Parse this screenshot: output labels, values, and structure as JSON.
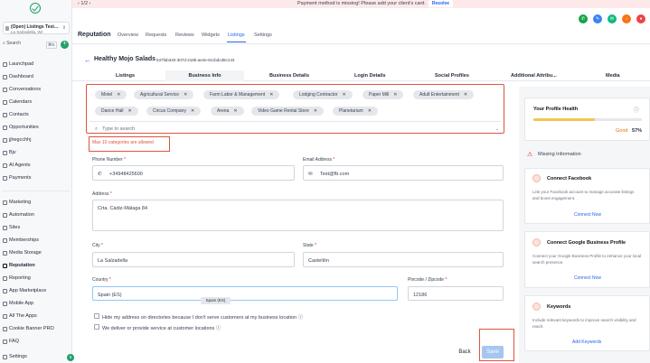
{
  "sidebar": {
    "location_name": "(Open) Listings Test...",
    "location_sub": "La Salzadella, WI",
    "search_label": "Search",
    "search_shortcut": "⌘K",
    "add_label": "+",
    "items": [
      {
        "label": "Launchpad"
      },
      {
        "label": "Dashboard"
      },
      {
        "label": "Conversations"
      },
      {
        "label": "Calendars"
      },
      {
        "label": "Contacts"
      },
      {
        "label": "Opportunities"
      },
      {
        "label": "jjhegcchhj"
      },
      {
        "label": "Bjv"
      },
      {
        "label": "AI Agents"
      },
      {
        "label": "Payments"
      },
      {
        "label": "Marketing"
      },
      {
        "label": "Automation"
      },
      {
        "label": "Sites"
      },
      {
        "label": "Memberships"
      },
      {
        "label": "Media Storage"
      },
      {
        "label": "Reputation"
      },
      {
        "label": "Reporting"
      },
      {
        "label": "App Marketplace"
      },
      {
        "label": "Mobile App"
      },
      {
        "label": "All The Apps"
      },
      {
        "label": "Cookie Banner PRO"
      },
      {
        "label": "FAQ"
      },
      {
        "label": "Settings"
      }
    ],
    "badge": "6"
  },
  "topbar": {
    "page": "1/2",
    "message": "Payment method is missing! Please add your client's card.",
    "resolve": "Resolve"
  },
  "header": {
    "title": "Reputation",
    "tabs": [
      "Overview",
      "Requests",
      "Reviews",
      "Widgets",
      "Listings",
      "Settings"
    ]
  },
  "listing": {
    "back": "←",
    "name": "Healthy Mojo Salads",
    "id": "537fab340-307d-418b-ae4e-8ccbdcd6c133"
  },
  "subtabs": [
    "Listings",
    "Business Info",
    "Business Details",
    "Login Details",
    "Social Profiles",
    "Additional Attribu...",
    "Media"
  ],
  "categories": {
    "chips": [
      "Motel",
      "Agricultural Service",
      "Farm Labor & Management",
      "Lodging Contractor",
      "Paper Mill",
      "Adult Entertainment",
      "Dance Hall",
      "Circus Company",
      "Arena",
      "Video Game Rental Store",
      "Planetarium"
    ],
    "placeholder": "Type to search",
    "error": "Max 10 categories are allowed"
  },
  "form": {
    "phone_label": "Phone Number",
    "phone_value": "+34948425600",
    "email_label": "Email Address",
    "email_value": "Test@fb.com",
    "address_label": "Address",
    "address_value": "Crta. Cádiz-Málaga 84",
    "city_label": "City",
    "city_value": "La Salzadella",
    "state_label": "State",
    "state_value": "Castellón",
    "country_label": "Country",
    "country_value": "Spain (ES)",
    "country_tooltip": "Spain (ES)",
    "zip_label": "Pincode / Zipcode",
    "zip_value": "12186",
    "hide_address": "Hide my address on directories because I don't serve customers at my business location",
    "deliver": "We deliver or provide service at customer locations",
    "required": "*"
  },
  "actions": {
    "back": "Back",
    "save": "Save"
  },
  "right": {
    "health_title": "Your Profile Health",
    "health_status": "Good",
    "health_pct": "57%",
    "health_fraction": 0.57,
    "missing_title": "Missing Information",
    "cards": [
      {
        "title": "Connect Facebook",
        "desc": "Link your Facebook account to manage accurate listings and boost engagement.",
        "link": "Connect Now"
      },
      {
        "title": "Connect Google Business Profile",
        "desc": "Connect your Google Business Profile to enhance your local search presence.",
        "link": "Connect Now"
      },
      {
        "title": "Keywords",
        "desc": "Include relevant keywords to improve search visibility and reach.",
        "link": "Add Keywords"
      }
    ]
  },
  "colors": {
    "accent": "#2563eb",
    "brand": "#22a06b",
    "error": "#dc5443",
    "banner": "#fde9ea"
  }
}
